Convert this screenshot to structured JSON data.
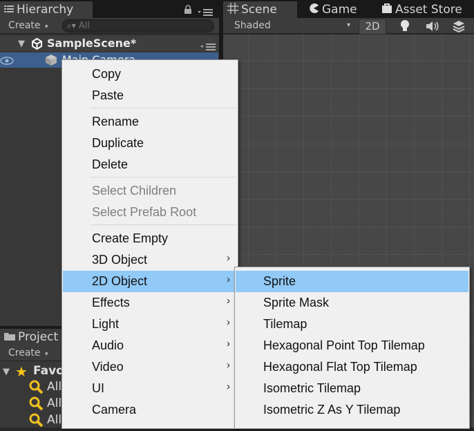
{
  "hierarchy": {
    "tab_label": "Hierarchy",
    "create_label": "Create",
    "search_placeholder": "All",
    "scene_name": "SampleScene*",
    "object_name": "Main Camera"
  },
  "scene_tabs": {
    "scene_label": "Scene",
    "game_label": "Game",
    "asset_store_label": "Asset Store",
    "shading_mode": "Shaded",
    "mode_2d": "2D"
  },
  "project": {
    "tab_label": "Project",
    "create_label": "Create",
    "favorites_label": "Favorites",
    "items": [
      "All Materials",
      "All Models",
      "All Prefabs"
    ]
  },
  "context_menu": {
    "items": [
      {
        "label": "Copy"
      },
      {
        "label": "Paste"
      },
      {
        "label": "Rename"
      },
      {
        "label": "Duplicate"
      },
      {
        "label": "Delete"
      },
      {
        "label": "Select Children"
      },
      {
        "label": "Select Prefab Root"
      },
      {
        "label": "Create Empty"
      },
      {
        "label": "3D Object"
      },
      {
        "label": "2D Object"
      },
      {
        "label": "Effects"
      },
      {
        "label": "Light"
      },
      {
        "label": "Audio"
      },
      {
        "label": "Video"
      },
      {
        "label": "UI"
      },
      {
        "label": "Camera"
      }
    ]
  },
  "submenu_2d": {
    "items": [
      {
        "label": "Sprite"
      },
      {
        "label": "Sprite Mask"
      },
      {
        "label": "Tilemap"
      },
      {
        "label": "Hexagonal Point Top Tilemap"
      },
      {
        "label": "Hexagonal Flat Top Tilemap"
      },
      {
        "label": "Isometric Tilemap"
      },
      {
        "label": "Isometric Z As Y Tilemap"
      }
    ]
  },
  "colors": {
    "highlight": "#91c9f7",
    "selection": "#3d5f8d",
    "menu_bg": "#f0f0f0"
  }
}
